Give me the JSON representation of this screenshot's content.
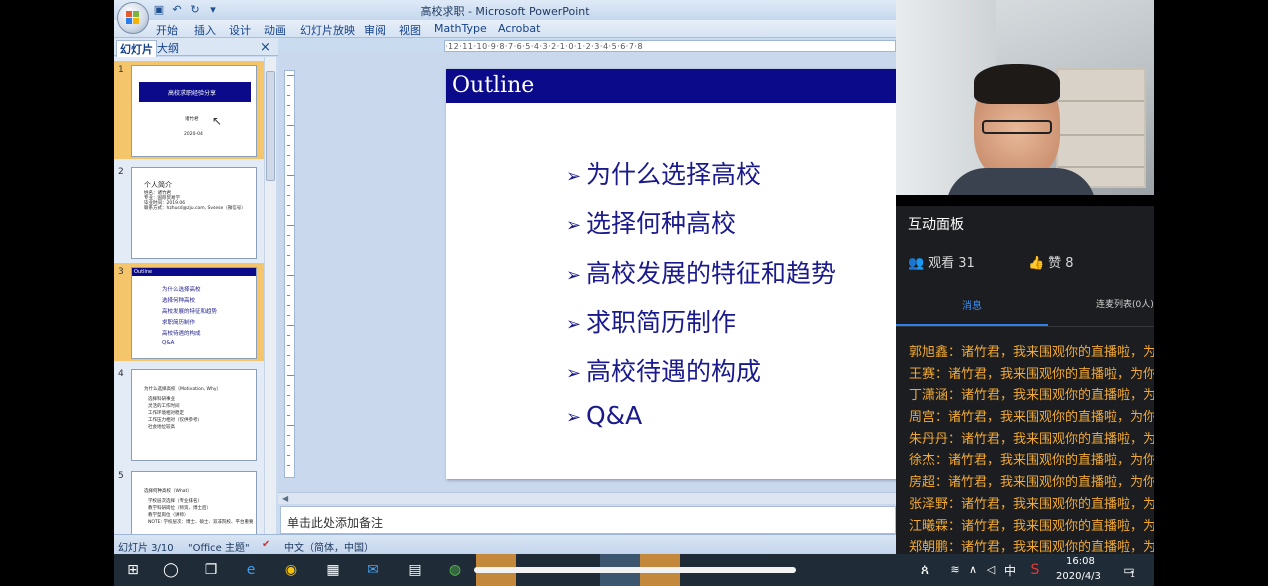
{
  "window": {
    "title": "高校求职 - Microsoft PowerPoint"
  },
  "menu": {
    "tabs": [
      "开始",
      "插入",
      "设计",
      "动画",
      "幻灯片放映",
      "审阅",
      "视图",
      "MathType",
      "Acrobat"
    ]
  },
  "ruler": {
    "horizontal": "·12·11·10·9·8·7·6·5·4·3·2·1·0·1·2·3·4·5·6·7·8"
  },
  "left_pane": {
    "tab_slides": "幻灯片",
    "tab_outline": "大纲",
    "close": "×",
    "thumbnails": [
      {
        "num": "1",
        "title": "高校求职经验分享",
        "author": "诸竹君",
        "date": "2020-04"
      },
      {
        "num": "2",
        "heading": "个人简介",
        "lines": [
          "姓名：诸竹君",
          "专业：国际贸易学",
          "毕业时间：2019.06",
          "联系方式：hzhusd@zju.com, Svsese（微信号）"
        ]
      },
      {
        "num": "3",
        "title": "Outline",
        "lines": [
          "为什么选择高校",
          "选择何种高校",
          "高校发展的特征和趋势",
          "求职简历制作",
          "高校待遇的构成",
          "Q&A"
        ]
      },
      {
        "num": "4",
        "heading": "为什么选择高校（Motivation, Why）",
        "lines": [
          "选择科研事业",
          "灵活的工作时间",
          "工作环境相对稳定",
          "工作压力相对（仅供参考）",
          "社会地位较高"
        ]
      },
      {
        "num": "5",
        "heading": "选择何种高校（What）",
        "lines": [
          "学校层次选择（专业排名）",
          "教学科研岗位（师资、博士后）",
          "教学型岗位（讲师）",
          "NOTE: 学校层次：博士、硕士、双非院校、平台重要"
        ]
      }
    ]
  },
  "slide": {
    "title": "Outline",
    "bullet_mark": "➢",
    "bullets": [
      "为什么选择高校",
      "选择何种高校",
      "高校发展的特征和趋势",
      "求职简历制作",
      "高校待遇的构成",
      "Q&A"
    ]
  },
  "notes": {
    "placeholder": "单击此处添加备注"
  },
  "status": {
    "slide_count": "幻灯片 3/10",
    "theme": "\"Office 主题\"",
    "language": "中文（简体，中国）"
  },
  "live_panel": {
    "title": "互动面板",
    "viewers_label": "观看 31",
    "likes_label": "赞 8",
    "tab_messages": "消息",
    "tab_mic": "连麦列表(0人)",
    "messages": [
      "郭旭鑫：诸竹君，我来围观你的直播啦，为",
      "王赛：诸竹君，我来围观你的直播啦，为你",
      "丁潇涵：诸竹君，我来围观你的直播啦，为",
      "周宫：诸竹君，我来围观你的直播啦，为你",
      "朱丹丹：诸竹君，我来围观你的直播啦，为",
      "徐杰：诸竹君，我来围观你的直播啦，为你",
      "房超：诸竹君，我来围观你的直播啦，为你",
      "张泽野：诸竹君，我来围观你的直播啦，为",
      "江曦霖：诸竹君，我来围观你的直播啦，为",
      "郑朝鹏：诸竹君，我来围观你的直播啦，为"
    ]
  },
  "taskbar": {
    "ime": "中",
    "time": "16:08",
    "date": "2020/4/3",
    "notification_count": "1"
  },
  "colors": {
    "slide_title_bar": "#0a0a8a",
    "bullet_text": "#1a1a8c",
    "message_text": "#f0a934",
    "selected_thumb": "#f4c56b",
    "active_tab": "#2f7fe8"
  }
}
